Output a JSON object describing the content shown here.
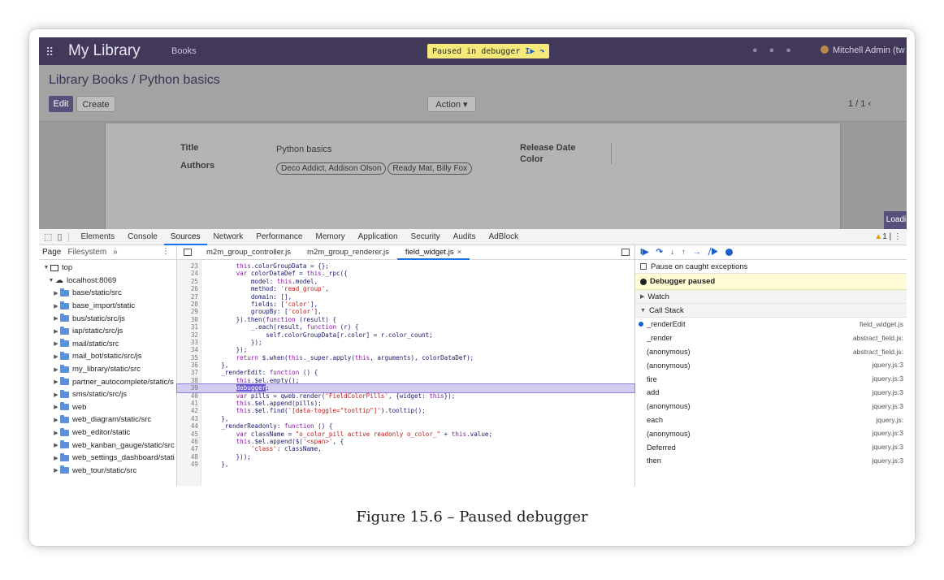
{
  "odoo": {
    "app_title": "My Library",
    "menu_books": "Books",
    "paused_banner": "Paused in debugger",
    "resume_glyph": "I▶",
    "step_over_glyph": "↷",
    "user": "Mitchell Admin (tw",
    "breadcrumb": "Library Books / Python basics",
    "edit_label": "Edit",
    "create_label": "Create",
    "action_label": "Action ▾",
    "pager": "1 / 1  ‹",
    "loading": "Loadi",
    "fields": {
      "title_label": "Title",
      "title_value": "Python basics",
      "authors_label": "Authors",
      "authors": [
        "Deco Addict, Addison Olson",
        "Ready Mat, Billy Fox"
      ],
      "release_label": "Release Date",
      "color_label": "Color"
    }
  },
  "devtools": {
    "tabs": [
      "Elements",
      "Console",
      "Sources",
      "Network",
      "Performance",
      "Memory",
      "Application",
      "Security",
      "Audits",
      "AdBlock"
    ],
    "active_tab": "Sources",
    "warning_count": "1",
    "navigator": {
      "tab_page": "Page",
      "tab_filesystem": "Filesystem",
      "more": "»",
      "tree": [
        {
          "label": "top",
          "kind": "frame",
          "indent": 0
        },
        {
          "label": "localhost:8069",
          "kind": "cloud",
          "indent": 1
        },
        {
          "label": "base/static/src",
          "kind": "folder",
          "indent": 2
        },
        {
          "label": "base_import/static",
          "kind": "folder",
          "indent": 2
        },
        {
          "label": "bus/static/src/js",
          "kind": "folder",
          "indent": 2
        },
        {
          "label": "iap/static/src/js",
          "kind": "folder",
          "indent": 2
        },
        {
          "label": "mail/static/src",
          "kind": "folder",
          "indent": 2
        },
        {
          "label": "mail_bot/static/src/js",
          "kind": "folder",
          "indent": 2
        },
        {
          "label": "my_library/static/src",
          "kind": "folder",
          "indent": 2
        },
        {
          "label": "partner_autocomplete/static/s",
          "kind": "folder",
          "indent": 2
        },
        {
          "label": "sms/static/src/js",
          "kind": "folder",
          "indent": 2
        },
        {
          "label": "web",
          "kind": "folder",
          "indent": 2
        },
        {
          "label": "web_diagram/static/src",
          "kind": "folder",
          "indent": 2
        },
        {
          "label": "web_editor/static",
          "kind": "folder",
          "indent": 2
        },
        {
          "label": "web_kanban_gauge/static/src",
          "kind": "folder",
          "indent": 2
        },
        {
          "label": "web_settings_dashboard/stati",
          "kind": "folder",
          "indent": 2
        },
        {
          "label": "web_tour/static/src",
          "kind": "folder",
          "indent": 2
        }
      ]
    },
    "editor": {
      "files": [
        "m2m_group_controller.js",
        "m2m_group_renderer.js",
        "field_widget.js"
      ],
      "active_file": "field_widget.js",
      "close": "×",
      "lines": [
        {
          "n": "23",
          "t": "        this.colorGroupData = {};"
        },
        {
          "n": "24",
          "t": "        var colorDataDef = this._rpc({"
        },
        {
          "n": "25",
          "t": "            model: this.model,"
        },
        {
          "n": "26",
          "t": "            method: 'read_group',"
        },
        {
          "n": "27",
          "t": "            domain: [],"
        },
        {
          "n": "28",
          "t": "            fields: ['color'],"
        },
        {
          "n": "29",
          "t": "            groupBy: ['color'],"
        },
        {
          "n": "30",
          "t": "        }).then(function (result) {"
        },
        {
          "n": "31",
          "t": "            _.each(result, function (r) {"
        },
        {
          "n": "32",
          "t": "                self.colorGroupData[r.color] = r.color_count;"
        },
        {
          "n": "33",
          "t": "            });"
        },
        {
          "n": "34",
          "t": "        });"
        },
        {
          "n": "35",
          "t": "        return $.when(this._super.apply(this, arguments), colorDataDef);"
        },
        {
          "n": "36",
          "t": "    },"
        },
        {
          "n": "37",
          "t": "    _renderEdit: function () {"
        },
        {
          "n": "38",
          "t": "        this.$el.empty();"
        },
        {
          "n": "39",
          "t": "        debugger;"
        },
        {
          "n": "40",
          "t": "        var pills = qweb.render('FieldColorPills', {widget: this});"
        },
        {
          "n": "41",
          "t": "        this.$el.append(pills);"
        },
        {
          "n": "42",
          "t": "        this.$el.find('[data-toggle=\"tooltip\"]').tooltip();"
        },
        {
          "n": "43",
          "t": "    },"
        },
        {
          "n": "44",
          "t": "    _renderReadonly: function () {"
        },
        {
          "n": "45",
          "t": "        var className = \"o_color_pill active readonly o_color_\" + this.value;"
        },
        {
          "n": "46",
          "t": "        this.$el.append($('<span>', {"
        },
        {
          "n": "47",
          "t": "            'class': className,"
        },
        {
          "n": "48",
          "t": "        }));"
        },
        {
          "n": "49",
          "t": "    },"
        }
      ],
      "paused_line": "39"
    },
    "debugger": {
      "toolbar": [
        "I▶",
        "↷",
        "↓",
        "↑",
        "→",
        "⧸▶"
      ],
      "pause_exceptions": "Pause on caught exceptions",
      "paused_msg": "Debugger paused",
      "watch": "Watch",
      "call_stack": "Call Stack",
      "frames": [
        {
          "fn": "_renderEdit",
          "loc": "field_widget.js",
          "current": true
        },
        {
          "fn": "_render",
          "loc": "abstract_field.js:",
          "current": false
        },
        {
          "fn": "(anonymous)",
          "loc": "abstract_field.js:",
          "current": false
        },
        {
          "fn": "(anonymous)",
          "loc": "jquery.js:3",
          "current": false
        },
        {
          "fn": "fire",
          "loc": "jquery.js:3",
          "current": false
        },
        {
          "fn": "add",
          "loc": "jquery.js:3",
          "current": false
        },
        {
          "fn": "(anonymous)",
          "loc": "jquery.js:3",
          "current": false
        },
        {
          "fn": "each",
          "loc": "jquery.js:",
          "current": false
        },
        {
          "fn": "(anonymous)",
          "loc": "jquery.js:3",
          "current": false
        },
        {
          "fn": "Deferred",
          "loc": "jquery.js:3",
          "current": false
        },
        {
          "fn": "then",
          "loc": "jquery.js:3",
          "current": false
        }
      ]
    }
  },
  "caption": "Figure 15.6 – Paused debugger"
}
